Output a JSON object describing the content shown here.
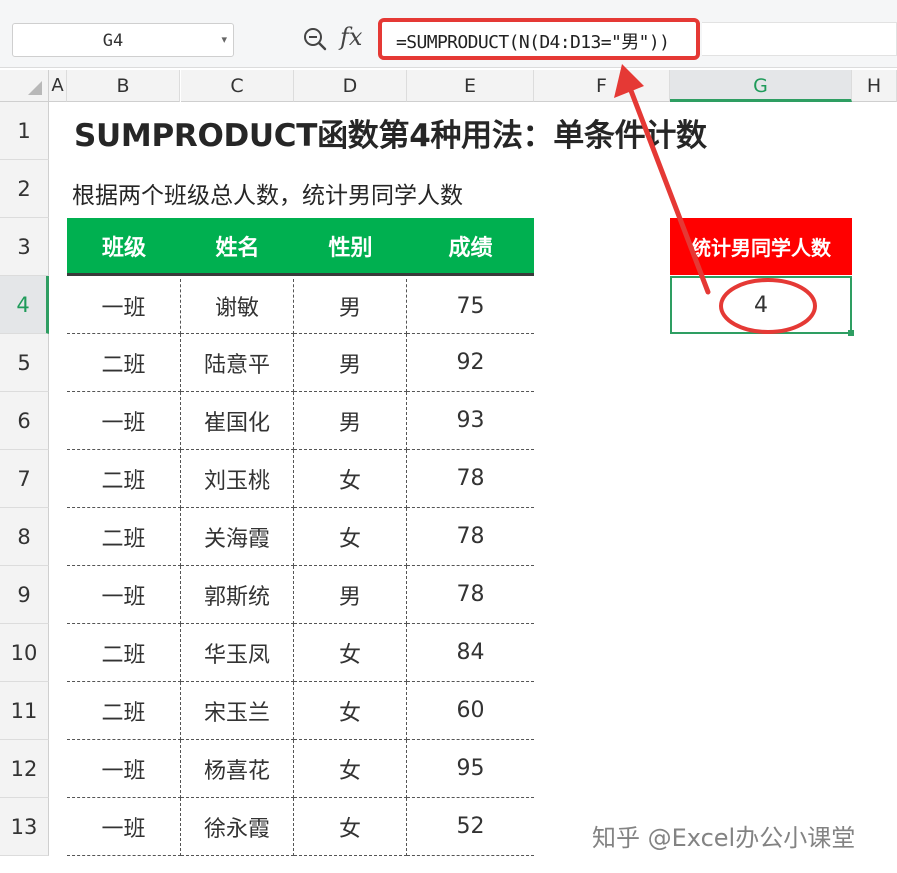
{
  "formula_bar": {
    "cell_name": "G4",
    "fx_label": "fx",
    "formula": "=SUMPRODUCT(N(D4:D13=\"男\"))"
  },
  "columns": [
    "A",
    "B",
    "C",
    "D",
    "E",
    "F",
    "G",
    "H"
  ],
  "selected_column": "G",
  "rows": [
    "1",
    "2",
    "3",
    "4",
    "5",
    "6",
    "7",
    "8",
    "9",
    "10",
    "11",
    "12",
    "13"
  ],
  "selected_row": "4",
  "sheet": {
    "title": "SUMPRODUCT函数第4种用法：单条件计数",
    "subtitle": "根据两个班级总人数，统计男同学人数",
    "table": {
      "headers": [
        "班级",
        "姓名",
        "性别",
        "成绩"
      ],
      "rows": [
        [
          "一班",
          "谢敏",
          "男",
          "75"
        ],
        [
          "二班",
          "陆意平",
          "男",
          "92"
        ],
        [
          "一班",
          "崔国化",
          "男",
          "93"
        ],
        [
          "二班",
          "刘玉桃",
          "女",
          "78"
        ],
        [
          "二班",
          "关海霞",
          "女",
          "78"
        ],
        [
          "一班",
          "郭斯统",
          "男",
          "78"
        ],
        [
          "二班",
          "华玉凤",
          "女",
          "84"
        ],
        [
          "二班",
          "宋玉兰",
          "女",
          "60"
        ],
        [
          "一班",
          "杨喜花",
          "女",
          "95"
        ],
        [
          "一班",
          "徐永霞",
          "女",
          "52"
        ]
      ]
    },
    "result_header": "统计男同学人数",
    "result_value": "4"
  },
  "watermark": "知乎 @Excel办公小课堂",
  "colors": {
    "header_green": "#00b050",
    "result_red": "#ff0000",
    "annotation_red": "#e53935",
    "selection_green": "#2e9e62"
  },
  "icons": [
    "zoom-icon",
    "dropdown-caret-icon"
  ]
}
